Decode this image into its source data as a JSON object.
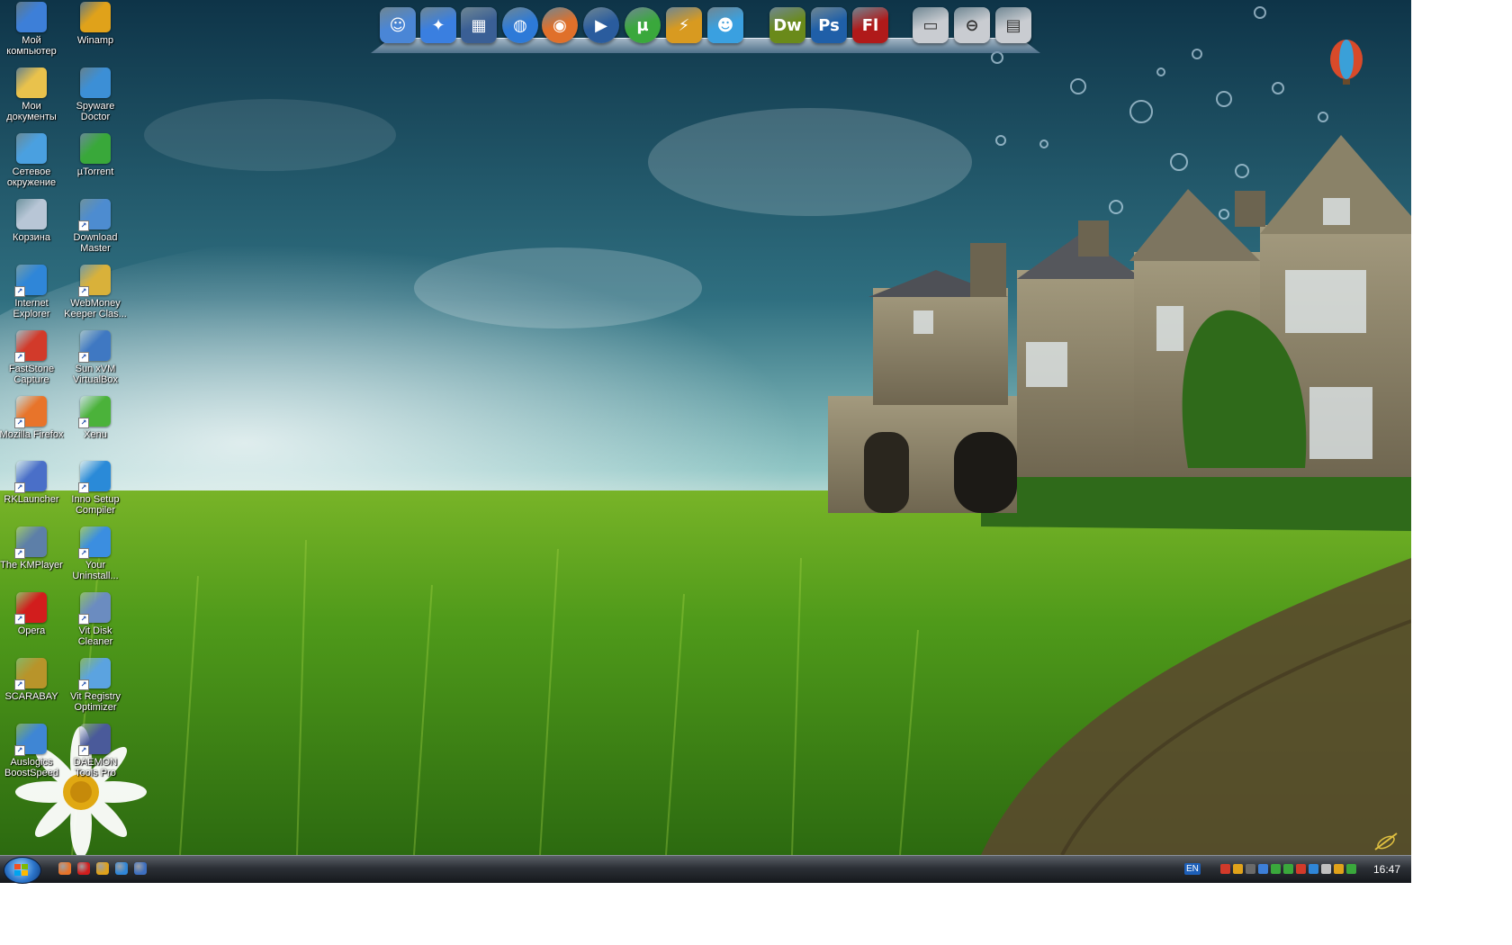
{
  "desktop": {
    "icons": [
      {
        "label": "Мой компьютер",
        "icon": "computer-icon",
        "color": "#3d7fd8"
      },
      {
        "label": "Winamp",
        "icon": "winamp-icon",
        "color": "#e0a21a"
      },
      {
        "label": "Мои документы",
        "icon": "documents-folder-icon",
        "color": "#e9c24c"
      },
      {
        "label": "Spyware Doctor",
        "icon": "spyware-doctor-icon",
        "color": "#3c8fd6"
      },
      {
        "label": "Сетевое окружение",
        "icon": "network-icon",
        "color": "#4aa0e0"
      },
      {
        "label": "µTorrent",
        "icon": "utorrent-icon",
        "color": "#39a83a"
      },
      {
        "label": "Корзина",
        "icon": "recycle-bin-icon",
        "color": "#b8c6d6"
      },
      {
        "label": "Download Master",
        "icon": "download-master-icon",
        "color": "#4d8cd0"
      },
      {
        "label": "Internet Explorer",
        "icon": "internet-explorer-icon",
        "color": "#2f86d8"
      },
      {
        "label": "WebMoney Keeper Clas...",
        "icon": "webmoney-icon",
        "color": "#d9b13a"
      },
      {
        "label": "FastStone Capture",
        "icon": "faststone-icon",
        "color": "#d23a2a"
      },
      {
        "label": "Sun xVM VirtualBox",
        "icon": "virtualbox-icon",
        "color": "#3f78c2"
      },
      {
        "label": "Mozilla Firefox",
        "icon": "firefox-icon",
        "color": "#e8742a"
      },
      {
        "label": "Xenu",
        "icon": "xenu-icon",
        "color": "#4bb23a"
      },
      {
        "label": "RKLauncher",
        "icon": "rklauncher-icon",
        "color": "#4a6fc8"
      },
      {
        "label": "Inno Setup Compiler",
        "icon": "inno-setup-icon",
        "color": "#2a8ad8"
      },
      {
        "label": "The KMPlayer",
        "icon": "kmplayer-icon",
        "color": "#5d7fa8"
      },
      {
        "label": "Your Uninstall...",
        "icon": "your-uninstaller-icon",
        "color": "#3b8ee0"
      },
      {
        "label": "Opera",
        "icon": "opera-icon",
        "color": "#d21d1d"
      },
      {
        "label": "Vit Disk Cleaner",
        "icon": "disk-cleaner-icon",
        "color": "#6b8cc0"
      },
      {
        "label": "SCARABAY",
        "icon": "scarabay-icon",
        "color": "#b8942a"
      },
      {
        "label": "Vit Registry Optimizer",
        "icon": "registry-optimizer-icon",
        "color": "#5ba3e0"
      },
      {
        "label": "Auslogics BoostSpeed",
        "icon": "boostspeed-icon",
        "color": "#3f86d4"
      },
      {
        "label": "DAEMON Tools Pro",
        "icon": "daemon-tools-icon",
        "color": "#4a5a9a"
      }
    ]
  },
  "dock": {
    "items": [
      {
        "icon": "finder-icon",
        "glyph": "☺",
        "color": "#4a86d6",
        "round": false
      },
      {
        "icon": "safari-icon",
        "glyph": "✦",
        "color": "#3a7fe0",
        "round": false
      },
      {
        "icon": "window-manager-icon",
        "glyph": "▦",
        "color": "#3a5f95",
        "round": false
      },
      {
        "icon": "network-globe-icon",
        "glyph": "◍",
        "color": "#2d7ad8",
        "round": true
      },
      {
        "icon": "firefox-icon",
        "glyph": "◉",
        "color": "#e0702a",
        "round": true
      },
      {
        "icon": "media-player-icon",
        "glyph": "▶",
        "color": "#2a5c9e",
        "round": true
      },
      {
        "icon": "utorrent-icon",
        "glyph": "µ",
        "color": "#3aa83c",
        "round": true
      },
      {
        "icon": "winamp-icon",
        "glyph": "⚡",
        "color": "#d89a20",
        "round": false
      },
      {
        "icon": "messenger-icon",
        "glyph": "☻",
        "color": "#3aa0e0",
        "round": false
      },
      {
        "icon": "dreamweaver-icon",
        "glyph": "Dw",
        "color": "#6a8a1a",
        "round": false
      },
      {
        "icon": "photoshop-icon",
        "glyph": "Ps",
        "color": "#1f5fa8",
        "round": false
      },
      {
        "icon": "flash-icon",
        "glyph": "Fl",
        "color": "#b01a1a",
        "round": false
      },
      {
        "icon": "drive-icon",
        "glyph": "▭",
        "color": "#c9ccd1",
        "round": false
      },
      {
        "icon": "drive-eject-icon",
        "glyph": "⊖",
        "color": "#c9ccd1",
        "round": false
      },
      {
        "icon": "card-reader-icon",
        "glyph": "▤",
        "color": "#c9ccd1",
        "round": false
      }
    ]
  },
  "taskbar": {
    "quick_launch": [
      {
        "icon": "firefox-icon",
        "color": "#e8742a"
      },
      {
        "icon": "opera-icon",
        "color": "#d21d1d"
      },
      {
        "icon": "winamp-icon",
        "color": "#e0a21a"
      },
      {
        "icon": "internet-explorer-icon",
        "color": "#2f86d8"
      },
      {
        "icon": "show-desktop-icon",
        "color": "#3d6fc0"
      }
    ],
    "language": "EN",
    "tray_icons": [
      {
        "icon": "tray-antivirus-icon",
        "color": "#d23a2a"
      },
      {
        "icon": "tray-winamp-icon",
        "color": "#e0a21a"
      },
      {
        "icon": "tray-daemon-icon",
        "color": "#6a6a6a"
      },
      {
        "icon": "tray-network-icon",
        "color": "#3d7fd8"
      },
      {
        "icon": "tray-icq-icon",
        "color": "#3aa83c"
      },
      {
        "icon": "tray-utorrent-icon",
        "color": "#3aa83c"
      },
      {
        "icon": "tray-security-icon",
        "color": "#d23a2a"
      },
      {
        "icon": "tray-ie-icon",
        "color": "#2f86d8"
      },
      {
        "icon": "tray-speaker-icon",
        "color": "#c0c0c0"
      },
      {
        "icon": "tray-messenger-icon",
        "color": "#e0a21a"
      },
      {
        "icon": "tray-safely-remove-icon",
        "color": "#3aa83c"
      }
    ],
    "clock": "16:47"
  }
}
